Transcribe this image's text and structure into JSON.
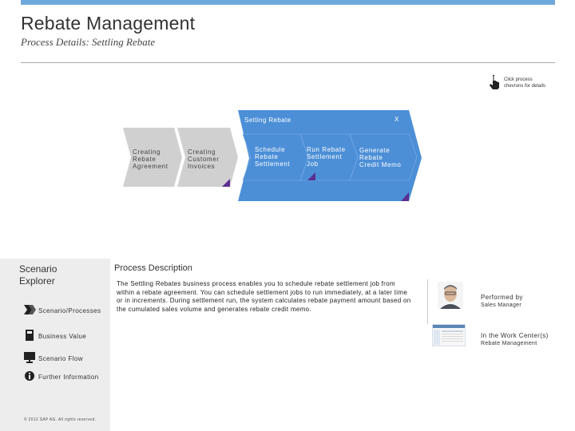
{
  "header": {
    "title": "Rebate Management",
    "subtitle": "Process Details: Settling Rebate"
  },
  "hint": {
    "icon": "pointer-hand-icon",
    "line1": "Click process",
    "line2": "chevrons for details"
  },
  "process_flow": {
    "steps": [
      {
        "lines": [
          "Creating",
          "Rebate",
          "Agreement"
        ]
      },
      {
        "lines": [
          "Creating",
          "Customer",
          "Invoices"
        ]
      }
    ],
    "group": {
      "title": "Setting Rebate",
      "close_label": "X",
      "steps": [
        {
          "lines": [
            "Schedule",
            "Rebate",
            "Settlement"
          ]
        },
        {
          "lines": [
            "Run Rebate",
            "Settlement",
            "Job"
          ]
        },
        {
          "lines": [
            "Generate",
            "Rebate",
            "Credit Memo"
          ]
        }
      ]
    },
    "colors": {
      "group": "#4c8fd7",
      "chevron": "#d0d0d0",
      "marker": "#5b2f90"
    }
  },
  "sidebar": {
    "title_line1": "Scenario",
    "title_line2": "Explorer",
    "items": [
      {
        "label": "Scenario/Processes",
        "icon": "chevron-arrows-icon"
      },
      {
        "label": "Business Value",
        "icon": "calculator-icon"
      },
      {
        "label": "Scenario Flow",
        "icon": "monitor-icon"
      },
      {
        "label": "Further Information",
        "icon": "info-icon"
      }
    ],
    "copyright": "© 2012 SAP AG. All rights reserved."
  },
  "description": {
    "title": "Process Description",
    "text": "The Settling Rebates business process enables you to schedule rebate settlement job from within a rebate agreement. You can schedule settlement jobs to run immediately, at a later time or in increments. During settlement run, the system calculates rebate payment amount based on the cumulated sales volume and generates rebate credit memo."
  },
  "roles": {
    "performed_by_label": "Performed by",
    "performed_by_value": "Sales Manager",
    "work_center_label": "In the Work Center(s)",
    "work_center_value": "Rebate Management"
  }
}
